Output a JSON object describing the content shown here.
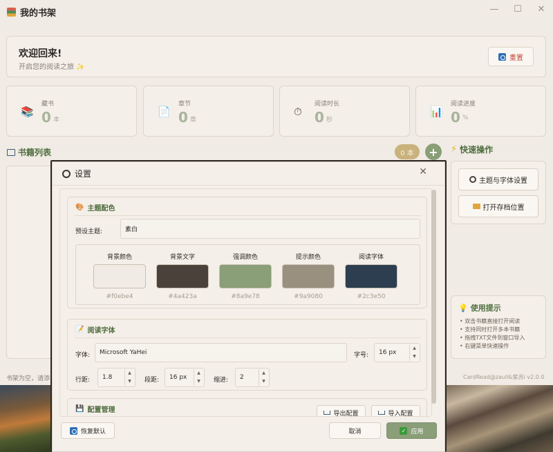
{
  "window": {
    "title": "我的书架",
    "controls": [
      "—",
      "☐",
      "✕"
    ]
  },
  "welcome": {
    "title": "欢迎回来!",
    "subtitle": "开启您的阅读之旅 ✨",
    "reset_label": "重置"
  },
  "stats": [
    {
      "label": "藏书",
      "value": "0",
      "unit": "本",
      "icon": "books-icon"
    },
    {
      "label": "章节",
      "value": "0",
      "unit": "章",
      "icon": "document-icon"
    },
    {
      "label": "阅读时长",
      "value": "0",
      "unit": "秒",
      "icon": "stopwatch-icon"
    },
    {
      "label": "阅读进度",
      "value": "0",
      "unit": "%",
      "icon": "bar-chart-icon"
    }
  ],
  "book_list": {
    "title": "书籍列表",
    "count": "0 本",
    "add": "+"
  },
  "quick_actions": {
    "title": "快速操作",
    "theme_button": "主题与字体设置",
    "folder_button": "打开存档位置"
  },
  "tips": {
    "title": "使用提示",
    "items": [
      "双击书籍直接打开阅读",
      "支持同时打开多本书籍",
      "拖拽TXT文件到窗口导入",
      "右键菜单快速操作"
    ]
  },
  "status": {
    "left": "书架为空，请添",
    "right": "CardRead@zaull&紫苏i   v2.0.0"
  },
  "dialog": {
    "title": "设置",
    "close": "✕",
    "theme": {
      "title": "主题配色",
      "preset_label": "预设主题:",
      "preset_value": "素白",
      "swatches": [
        {
          "label": "背景颜色",
          "hex": "#f0ebe4",
          "color": "#f0ebe4"
        },
        {
          "label": "背景文字",
          "hex": "#4a423a",
          "color": "#4a423a"
        },
        {
          "label": "强调颜色",
          "hex": "#8a9e78",
          "color": "#8a9e78"
        },
        {
          "label": "提示颜色",
          "hex": "#9a9080",
          "color": "#9a9080"
        },
        {
          "label": "阅读字体",
          "hex": "#2c3e50",
          "color": "#2c3e50"
        }
      ]
    },
    "reading_font": {
      "title": "阅读字体",
      "font_label": "字体:",
      "font_value": "Microsoft YaHei",
      "size_label": "字号:",
      "size_value": "16 px",
      "line_label": "行距:",
      "line_value": "1.8",
      "para_label": "段距:",
      "para_value": "16 px",
      "indent_label": "缩进:",
      "indent_value": "2"
    },
    "config": {
      "title": "配置管理",
      "export_label": "导出配置",
      "import_label": "导入配置"
    },
    "footer": {
      "restore_label": "恢复默认",
      "cancel_label": "取消",
      "apply_label": "应用"
    }
  }
}
